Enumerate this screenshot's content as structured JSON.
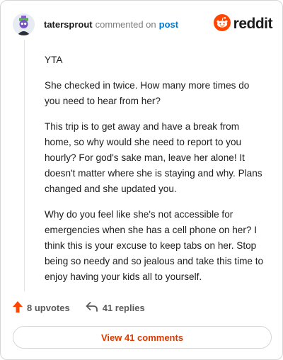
{
  "header": {
    "username": "tatersprout",
    "commented_text": "commented on",
    "post_link": "post",
    "brand": "reddit"
  },
  "comment": {
    "paragraphs": [
      "YTA",
      "She checked in twice. How many more times do you need to hear from her?",
      "This trip is to get away and have a break from home, so why would she need to report to you hourly? For god's sake man, leave her alone! It doesn't matter where she is staying and why. Plans changed and she updated you.",
      "Why do you feel like she's not accessible for emergencies when she has a cell phone on her? I think this is your excuse to keep tabs on her. Stop being so needy and so jealous and take this time to enjoy having your kids all to yourself."
    ]
  },
  "actions": {
    "upvotes": "8 upvotes",
    "replies": "41 replies"
  },
  "view_button": "View 41 comments",
  "colors": {
    "upvote": "#ff4500",
    "link": "#0079d3",
    "view_button_text": "#d93a00"
  },
  "icons": [
    "avatar",
    "reddit-logo-icon",
    "upvote-arrow-icon",
    "reply-arrow-icon"
  ]
}
